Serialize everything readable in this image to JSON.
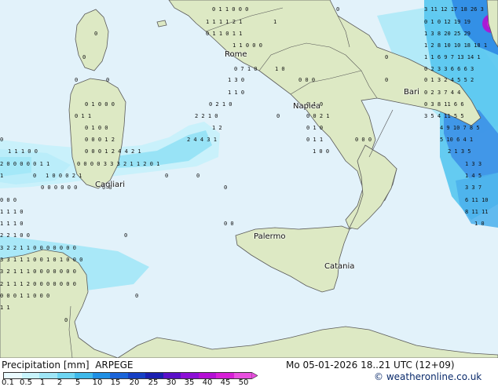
{
  "map": {
    "cities": [
      {
        "name": "Rome",
        "id": "rome"
      },
      {
        "name": "Bari",
        "id": "bari"
      },
      {
        "name": "Napiea",
        "id": "naples"
      },
      {
        "name": "Cagliari",
        "id": "cagliari"
      },
      {
        "name": "Palermo",
        "id": "palermo"
      },
      {
        "name": "Catania",
        "id": "catania"
      }
    ],
    "colors": {
      "sea": "#e2f2fa",
      "land": "#dde9c4",
      "border": "#555555",
      "precip_light": "#9fe6f7",
      "precip_mid": "#56c7ef",
      "precip_heavy": "#1f6fe0",
      "precip_extreme": "#b40fd4"
    }
  },
  "footer": {
    "title": "Precipitation [mm]",
    "model": "ARPEGE",
    "valid_time": "Mo 05-01-2026 18..21 UTC (12+09)",
    "copyright": "© weatheronline.co.uk",
    "scale_labels": [
      "0.1",
      "0.5",
      "1",
      "2",
      "5",
      "10",
      "15",
      "20",
      "25",
      "30",
      "35",
      "40",
      "45",
      "50"
    ],
    "scale_colors": [
      "#eafbff",
      "#c9f4fc",
      "#9fe6f7",
      "#6ed5f2",
      "#3fb9ea",
      "#1f8fe4",
      "#1a64d8",
      "#1640c4",
      "#1a1fb0",
      "#5a10c8",
      "#8d10d6",
      "#b40fd4",
      "#d61fd6",
      "#e84fdf"
    ]
  }
}
